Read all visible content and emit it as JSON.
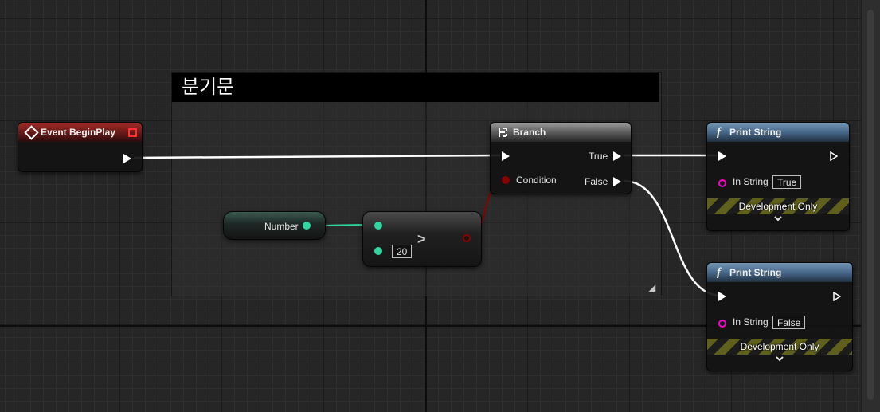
{
  "comment": {
    "title": "분기문"
  },
  "event_node": {
    "title": "Event BeginPlay"
  },
  "variable_node": {
    "label": "Number"
  },
  "compare_node": {
    "operator": ">",
    "value": "20"
  },
  "branch_node": {
    "title": "Branch",
    "true_label": "True",
    "false_label": "False",
    "condition_label": "Condition"
  },
  "print_true": {
    "title": "Print String",
    "in_string_label": "In String",
    "value": "True",
    "dev_only": "Development Only",
    "func_icon": "f"
  },
  "print_false": {
    "title": "Print String",
    "in_string_label": "In String",
    "value": "False",
    "dev_only": "Development Only",
    "func_icon": "f"
  },
  "icons": {
    "event": "event-diamond-icon",
    "branch": "branch-icon",
    "function": "function-icon",
    "expand": "chevron-down-icon"
  },
  "colors": {
    "exec_wire": "#ffffff",
    "int_pin": "#2fd6a0",
    "bool_pin": "#8d0000",
    "string_pin": "#ff00d4",
    "event_header": "#a12a26",
    "function_header": "#48688a"
  }
}
